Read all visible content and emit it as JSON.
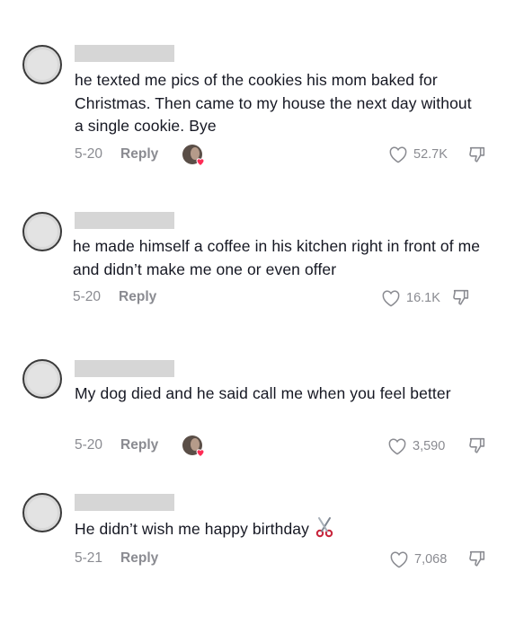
{
  "colors": {
    "text": "#161823",
    "muted": "#8a8b91",
    "redacted": "#d6d6d6",
    "creator_heart": "#fe2c55"
  },
  "icons": {
    "like": "heart-outline-icon",
    "dislike": "thumbs-down-outline-icon",
    "creator_like": "creator-liked-heart-icon",
    "emoji": "scissors-emoji"
  },
  "comments": [
    {
      "text": "he texted me pics of the cookies his mom baked for Christmas. Then came to my house the next day without a single cookie. Bye",
      "date": "5-20",
      "reply_label": "Reply",
      "creator_liked": true,
      "likes": "52.7K"
    },
    {
      "text": "he made himself a coffee in his kitchen right in front of me and didn’t make me one or even offer",
      "date": "5-20",
      "reply_label": "Reply",
      "creator_liked": false,
      "likes": "16.1K"
    },
    {
      "text": "My dog died and he said call me when you feel better",
      "date": "5-20",
      "reply_label": "Reply",
      "creator_liked": true,
      "likes": "3,590"
    },
    {
      "text": "He didn’t wish me happy birthday",
      "date": "5-21",
      "reply_label": "Reply",
      "creator_liked": false,
      "likes": "7,068"
    }
  ]
}
